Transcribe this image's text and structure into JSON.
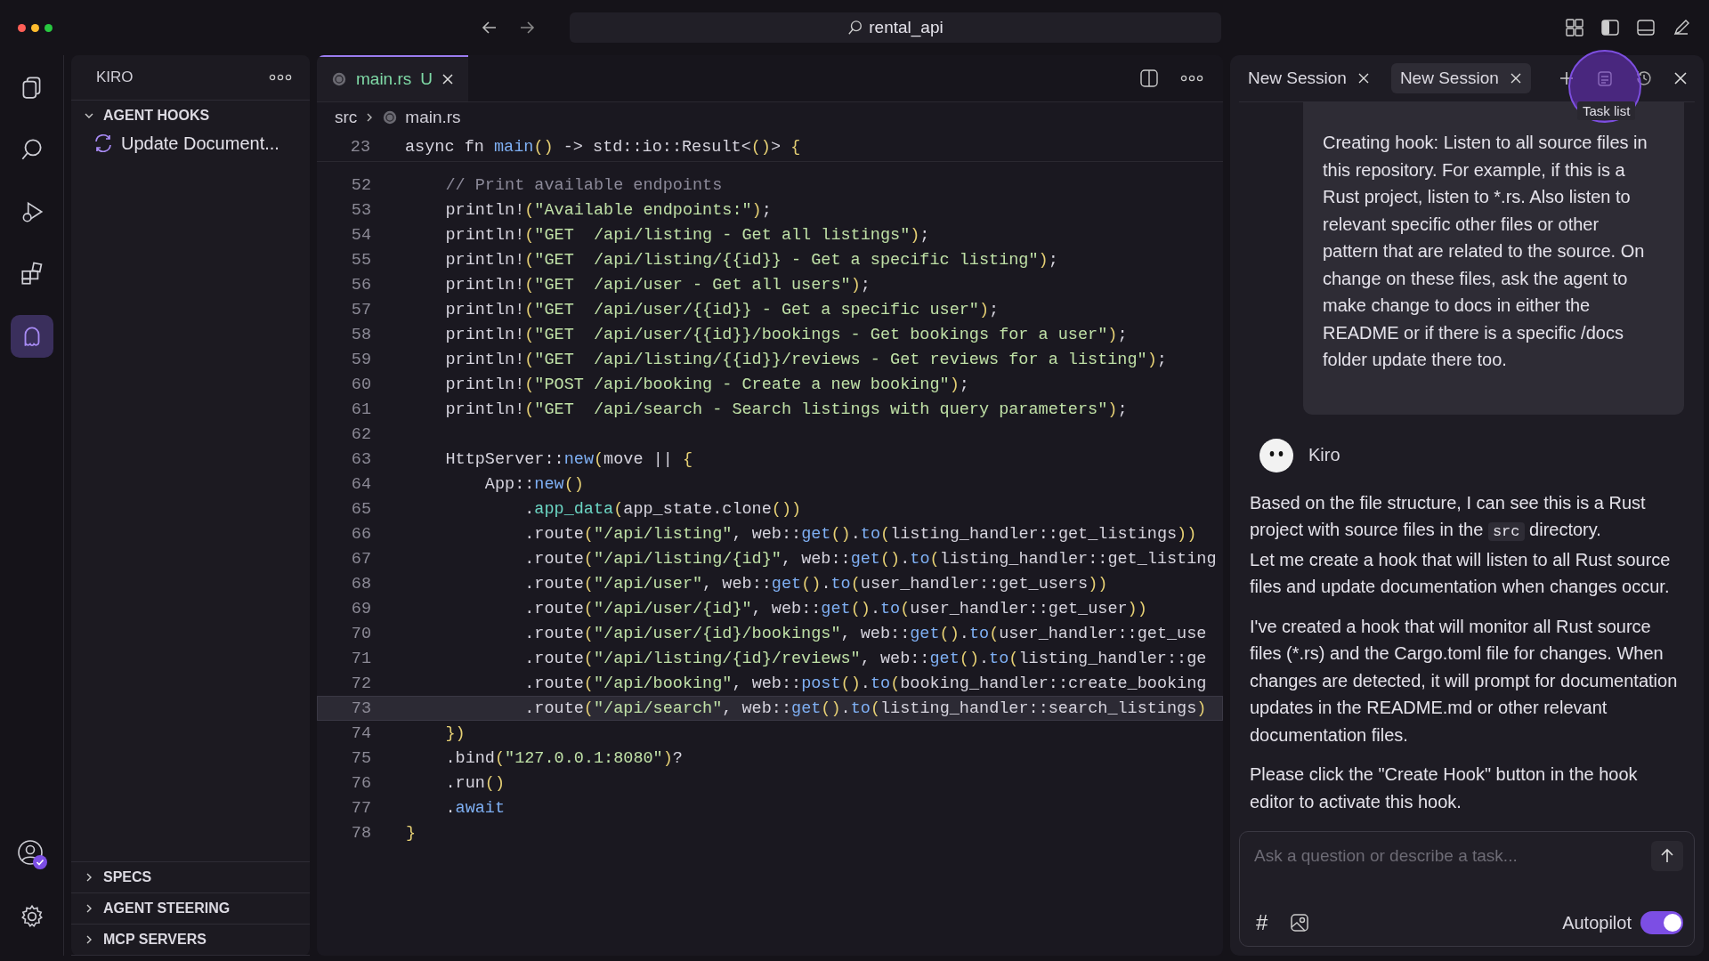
{
  "titlebar": {
    "search": "rental_api"
  },
  "activity_bar": {
    "items": [
      {
        "kind": "files",
        "selected": false
      },
      {
        "kind": "search",
        "selected": false
      },
      {
        "kind": "debug",
        "selected": false
      },
      {
        "kind": "extensions",
        "selected": false
      },
      {
        "kind": "kiro",
        "selected": true
      }
    ],
    "account_badge": true
  },
  "sidebar": {
    "title": "KIRO",
    "sections": [
      {
        "label": "AGENT HOOKS",
        "expanded": true,
        "items": [
          "Update Document..."
        ]
      },
      {
        "label": "SPECS",
        "expanded": false
      },
      {
        "label": "AGENT STEERING",
        "expanded": false
      },
      {
        "label": "MCP SERVERS",
        "expanded": false
      }
    ]
  },
  "editor": {
    "tabs": [
      {
        "label": "main.rs",
        "status": "U",
        "selected": true
      }
    ],
    "breadcrumb": [
      "src",
      "main.rs"
    ],
    "sticky_line": {
      "number": "23",
      "text": "async fn main() -> std::io::Result<()> {"
    },
    "lines": [
      {
        "number": "52",
        "current": false,
        "text": "    // Print available endpoints"
      },
      {
        "number": "53",
        "current": false,
        "text": "    println!(\"Available endpoints:\");"
      },
      {
        "number": "54",
        "current": false,
        "text": "    println!(\"GET  /api/listing - Get all listings\");"
      },
      {
        "number": "55",
        "current": false,
        "text": "    println!(\"GET  /api/listing/{{id}} - Get a specific listing\");"
      },
      {
        "number": "56",
        "current": false,
        "text": "    println!(\"GET  /api/user - Get all users\");"
      },
      {
        "number": "57",
        "current": false,
        "text": "    println!(\"GET  /api/user/{{id}} - Get a specific user\");"
      },
      {
        "number": "58",
        "current": false,
        "text": "    println!(\"GET  /api/user/{{id}}/bookings - Get bookings for a user\");"
      },
      {
        "number": "59",
        "current": false,
        "text": "    println!(\"GET  /api/listing/{{id}}/reviews - Get reviews for a listing\");"
      },
      {
        "number": "60",
        "current": false,
        "text": "    println!(\"POST /api/booking - Create a new booking\");"
      },
      {
        "number": "61",
        "current": false,
        "text": "    println!(\"GET  /api/search - Search listings with query parameters\");"
      },
      {
        "number": "62",
        "current": false
      },
      {
        "number": "63",
        "current": false,
        "text": "    HttpServer::new(move || {"
      },
      {
        "number": "64",
        "current": false,
        "text": "        App::new()"
      },
      {
        "number": "65",
        "current": false,
        "text": "            .app_data(app_state.clone())"
      },
      {
        "number": "66",
        "current": false,
        "text": "            .route(\"/api/listing\", web::get().to(listing_handler::get_listings))"
      },
      {
        "number": "67",
        "current": false,
        "text": "            .route(\"/api/listing/{id}\", web::get().to(listing_handler::get_listing"
      },
      {
        "number": "68",
        "current": false,
        "text": "            .route(\"/api/user\", web::get().to(user_handler::get_users))"
      },
      {
        "number": "69",
        "current": false,
        "text": "            .route(\"/api/user/{id}\", web::get().to(user_handler::get_user))"
      },
      {
        "number": "70",
        "current": false,
        "text": "            .route(\"/api/user/{id}/bookings\", web::get().to(user_handler::get_use"
      },
      {
        "number": "71",
        "current": false,
        "text": "            .route(\"/api/listing/{id}/reviews\", web::get().to(listing_handler::ge"
      },
      {
        "number": "72",
        "current": false,
        "text": "            .route(\"/api/booking\", web::post().to(booking_handler::create_booking"
      },
      {
        "number": "73",
        "current": true,
        "text": "            .route(\"/api/search\", web::get().to(listing_handler::search_listings)"
      },
      {
        "number": "74",
        "current": false,
        "text": "    })"
      },
      {
        "number": "75",
        "current": false,
        "text": "    .bind(\"127.0.0.1:8080\")?"
      },
      {
        "number": "76",
        "current": false,
        "text": "    .run()"
      },
      {
        "number": "77",
        "current": false,
        "text": "    .await"
      },
      {
        "number": "78",
        "current": false,
        "text": "}"
      }
    ]
  },
  "chat": {
    "tabs": [
      {
        "label": "New Session",
        "selected": false
      },
      {
        "label": "New Session",
        "selected": true
      }
    ],
    "tooltip": "Task list",
    "user_message": "Creating hook: Listen to all source files in this repository. For example, if this is a Rust project, listen to *.rs. Also listen to relevant specific other files or other pattern that are related to the source. On change on these files, ask the agent to make change to docs in either the README or if there is a specific /docs folder update there too.",
    "assistant": {
      "name": "Kiro",
      "paragraphs": [
        [
          [
            {
              "kind": "text",
              "t": "Based on the file structure, I can see this is a Rust project with source files in the "
            },
            {
              "kind": "code",
              "t": "src"
            },
            {
              "kind": "text",
              "t": " directory."
            }
          ],
          [
            {
              "kind": "text",
              "t": "Let me create a hook that will listen to all Rust source files and update documentation when changes occur."
            }
          ]
        ],
        [
          [
            {
              "kind": "text",
              "t": "I've created a hook that will monitor all Rust source files (*.rs) and the Cargo.toml file for changes. When changes are detected, it will prompt for documentation updates in the README.md or other relevant documentation files."
            }
          ]
        ],
        [
          [
            {
              "kind": "text",
              "t": "Please click the \"Create Hook\" button in the hook editor to activate this hook."
            }
          ]
        ]
      ]
    },
    "input": {
      "placeholder": "Ask a question or describe a task...",
      "context_symbol": "#",
      "autopilot_label": "Autopilot",
      "autopilot_on": true
    }
  }
}
